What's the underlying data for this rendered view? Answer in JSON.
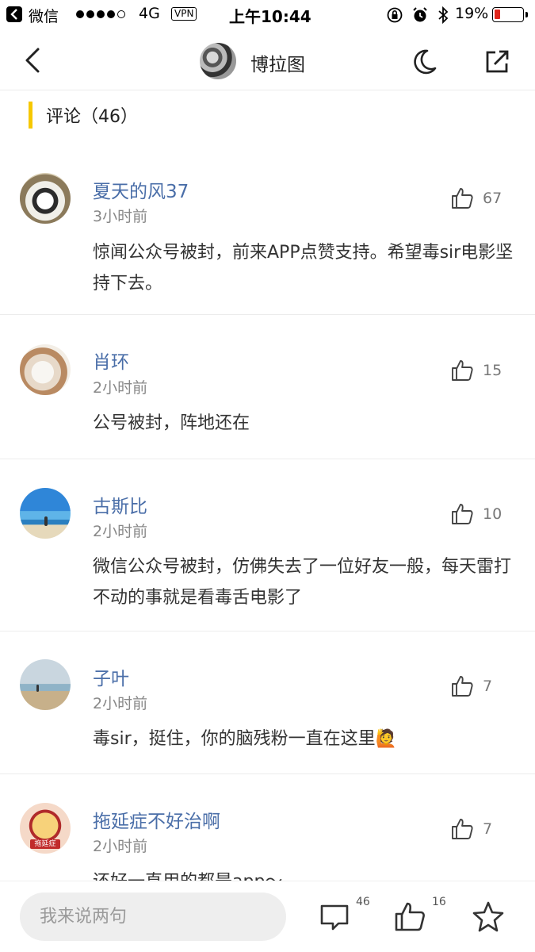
{
  "status_bar": {
    "app": "微信",
    "network": "4G",
    "vpn": "VPN",
    "time": "上午10:44",
    "battery": "19%",
    "battery_level": 0.19
  },
  "header": {
    "title": "博拉图"
  },
  "section": {
    "title": "评论（46）"
  },
  "comments": [
    {
      "name": "夏天的风37",
      "time": "3小时前",
      "likes": "67",
      "text": "惊闻公众号被封，前来APP点赞支持。希望毒sir电影坚持下去。"
    },
    {
      "name": "肖环",
      "time": "2小时前",
      "likes": "15",
      "text": "公号被封，阵地还在"
    },
    {
      "name": "古斯比",
      "time": "2小时前",
      "likes": "10",
      "text": "微信公众号被封，仿佛失去了一位好友一般，每天雷打不动的事就是看毒舌电影了"
    },
    {
      "name": "子叶",
      "time": "2小时前",
      "likes": "7",
      "text": "毒sir，挺住，你的脑残粉一直在这里🙋"
    },
    {
      "name": "拖延症不好治啊",
      "time": "2小时前",
      "likes": "7",
      "text": "还好一直用的都是app～"
    }
  ],
  "avatar_label": "拖延症",
  "bottom_bar": {
    "input_placeholder": "我来说两句",
    "comment_count": "46",
    "like_count": "16"
  },
  "colors": {
    "accent": "#f6c800",
    "username": "#4a6ea8",
    "battery_low": "#e0261c"
  },
  "icons": [
    "back-icon",
    "moon-icon",
    "share-icon",
    "like-icon",
    "comment-icon",
    "star-icon",
    "alarm-icon",
    "bluetooth-icon",
    "lock-rotation-icon"
  ]
}
